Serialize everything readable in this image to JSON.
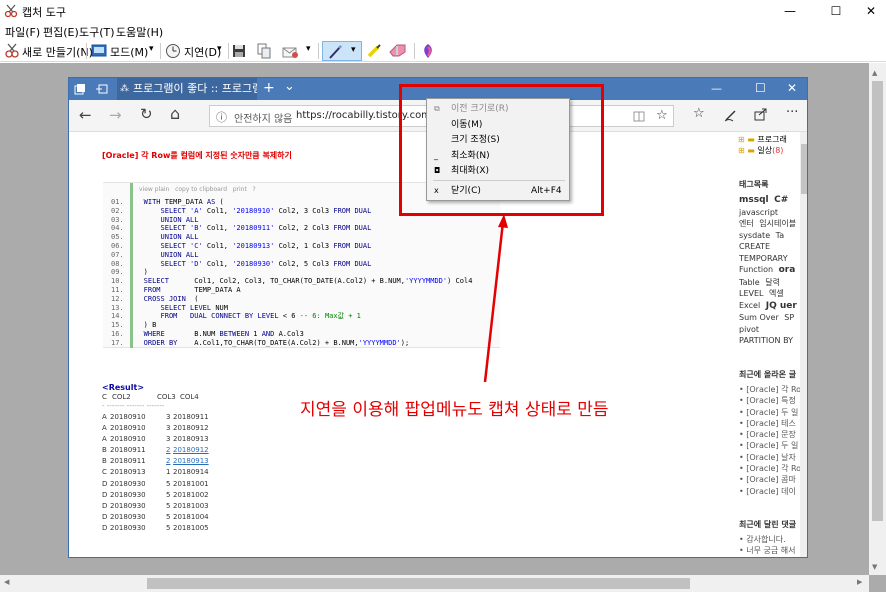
{
  "outer_window": {
    "title": "캡처 도구",
    "minimize": "—",
    "maximize": "☐",
    "close": "✕"
  },
  "menu": [
    "파일(F)",
    "편집(E)",
    "도구(T)",
    "도움말(H)"
  ],
  "toolbar": {
    "new_label": "새로 만들기(N)",
    "mode_label": "모드(M)",
    "delay_label": "지연(D)",
    "dropdown": "▾",
    "icons": [
      "new-capture-icon",
      "mode-icon",
      "delay-clock-icon",
      "save-icon",
      "copy-icon",
      "send-icon",
      "pen-icon",
      "highlighter-icon",
      "eraser-icon",
      "paint3d-icon"
    ]
  },
  "browser": {
    "tab_title": "프로그램이 좋다 :: 프로그램",
    "new_tab": "+",
    "tab_list": "⌄",
    "min": "—",
    "max": "☐",
    "close": "✕",
    "back": "←",
    "forward": "→",
    "refresh": "↻",
    "home": "⌂",
    "security": "ⓘ",
    "insecure_text": "안전하지 않음",
    "url": "https://rocabilly.tistory.com/",
    "icons": [
      "reading-view-icon",
      "favorite-star-icon",
      "favorites-list-icon",
      "pen-notes-icon",
      "share-icon",
      "more-icon"
    ]
  },
  "context_menu": [
    {
      "icon": "⧉",
      "label": "이전 크기로(R)",
      "shortcut": "",
      "disabled": true
    },
    {
      "icon": "",
      "label": "이동(M)",
      "shortcut": "",
      "disabled": false
    },
    {
      "icon": "",
      "label": "크기 조정(S)",
      "shortcut": "",
      "disabled": false
    },
    {
      "icon": "_",
      "label": "최소화(N)",
      "shortcut": "",
      "disabled": false
    },
    {
      "icon": "◘",
      "label": "최대화(X)",
      "shortcut": "",
      "disabled": false
    },
    {
      "icon": "x",
      "label": "닫기(C)",
      "shortcut": "Alt+F4",
      "disabled": false
    }
  ],
  "post": {
    "title": "[Oracle] 각 Row를 컬럼에 지정된 숫자만큼 복제하기",
    "code_toolbar": "view plain   copy to clipboard   print   ?",
    "code_lines": [
      {
        "n": "01.",
        "t": "WITH TEMP_DATA AS ("
      },
      {
        "n": "02.",
        "t": "    SELECT 'A' Col1, '20180910' Col2, 3 Col3 FROM DUAL"
      },
      {
        "n": "03.",
        "t": "    UNION ALL"
      },
      {
        "n": "04.",
        "t": "    SELECT 'B' Col1, '20180911' Col2, 2 Col3 FROM DUAL"
      },
      {
        "n": "05.",
        "t": "    UNION ALL"
      },
      {
        "n": "06.",
        "t": "    SELECT 'C' Col1, '20180913' Col2, 1 Col3 FROM DUAL"
      },
      {
        "n": "07.",
        "t": "    UNION ALL"
      },
      {
        "n": "08.",
        "t": "    SELECT 'D' Col1, '20180930' Col2, 5 Col3 FROM DUAL"
      },
      {
        "n": "09.",
        "t": ")"
      },
      {
        "n": "10.",
        "t": "SELECT      Col1, Col2, Col3, TO_CHAR(TO_DATE(A.Col2) + B.NUM,'YYYYMMDD') Col4"
      },
      {
        "n": "11.",
        "t": "FROM        TEMP_DATA A"
      },
      {
        "n": "12.",
        "t": "CROSS JOIN  ("
      },
      {
        "n": "13.",
        "t": "    SELECT LEVEL NUM"
      },
      {
        "n": "14.",
        "t": "    FROM   DUAL CONNECT BY LEVEL < 6 -- 6: Max값 + 1"
      },
      {
        "n": "15.",
        "t": ") B"
      },
      {
        "n": "16.",
        "t": "WHERE       B.NUM BETWEEN 1 AND A.Col3"
      },
      {
        "n": "17.",
        "t": "ORDER BY    A.Col1,TO_CHAR(TO_DATE(A.Col2) + B.NUM,'YYYYMMDD');"
      }
    ],
    "result_title": "<Result>",
    "result_header": [
      "C",
      "COL2",
      "COL3",
      "COL4"
    ],
    "result_divider": "- ------- ------- -------",
    "result_rows": [
      [
        "A",
        "20180910",
        "3",
        "20180911"
      ],
      [
        "A",
        "20180910",
        "3",
        "20180912"
      ],
      [
        "A",
        "20180910",
        "3",
        "20180913"
      ],
      [
        "B",
        "20180911",
        "2",
        "20180912"
      ],
      [
        "B",
        "20180911",
        "2",
        "20180913"
      ],
      [
        "C",
        "20180913",
        "1",
        "20180914"
      ],
      [
        "D",
        "20180930",
        "5",
        "20181001"
      ],
      [
        "D",
        "20180930",
        "5",
        "20181002"
      ],
      [
        "D",
        "20180930",
        "5",
        "20181003"
      ],
      [
        "D",
        "20180930",
        "5",
        "20181004"
      ],
      [
        "D",
        "20180930",
        "5",
        "20181005"
      ]
    ]
  },
  "sidebar": {
    "tree": [
      {
        "label": "프로그래",
        "count": ""
      },
      {
        "label": "일상",
        "count": "(8)"
      }
    ],
    "tag_title": "태그목록",
    "tags": [
      "mssql",
      "C#",
      "javascript",
      "엔터",
      "임시테이블",
      "sysdate",
      "Ta",
      "CREATE",
      "TEMPORARY",
      "Function",
      "ora",
      "Table",
      "달력",
      "LEVEL",
      "엑셀",
      "Excel",
      "JQ uer",
      "Sum Over",
      "SP",
      "pivot",
      "PARTITION BY"
    ],
    "recent_title": "최근에 올라온 글",
    "recent": [
      "[Oracle] 각 Ro",
      "[Oracle] 특정",
      "[Oracle] 두 일",
      "[Oracle] 테스",
      "[Oracle] 문장",
      "[Oracle] 두 일",
      "[Oracle] 날자",
      "[Oracle] 각 Ro",
      "[Oracle] 콤마",
      "[Oracle] 데이"
    ],
    "comments_title": "최근에 달린 댓글",
    "comments": [
      "감사합니다.",
      "너무 궁금 해서"
    ]
  },
  "annotation": "지연을 이용해 팝업메뉴도 캡쳐 상태로 만듬",
  "colors": {
    "browser_titlebar": "#4a7ab8",
    "annotation_red": "#e30000",
    "post_title_red": "#e00000",
    "code_bar_green": "#8ac38a"
  }
}
